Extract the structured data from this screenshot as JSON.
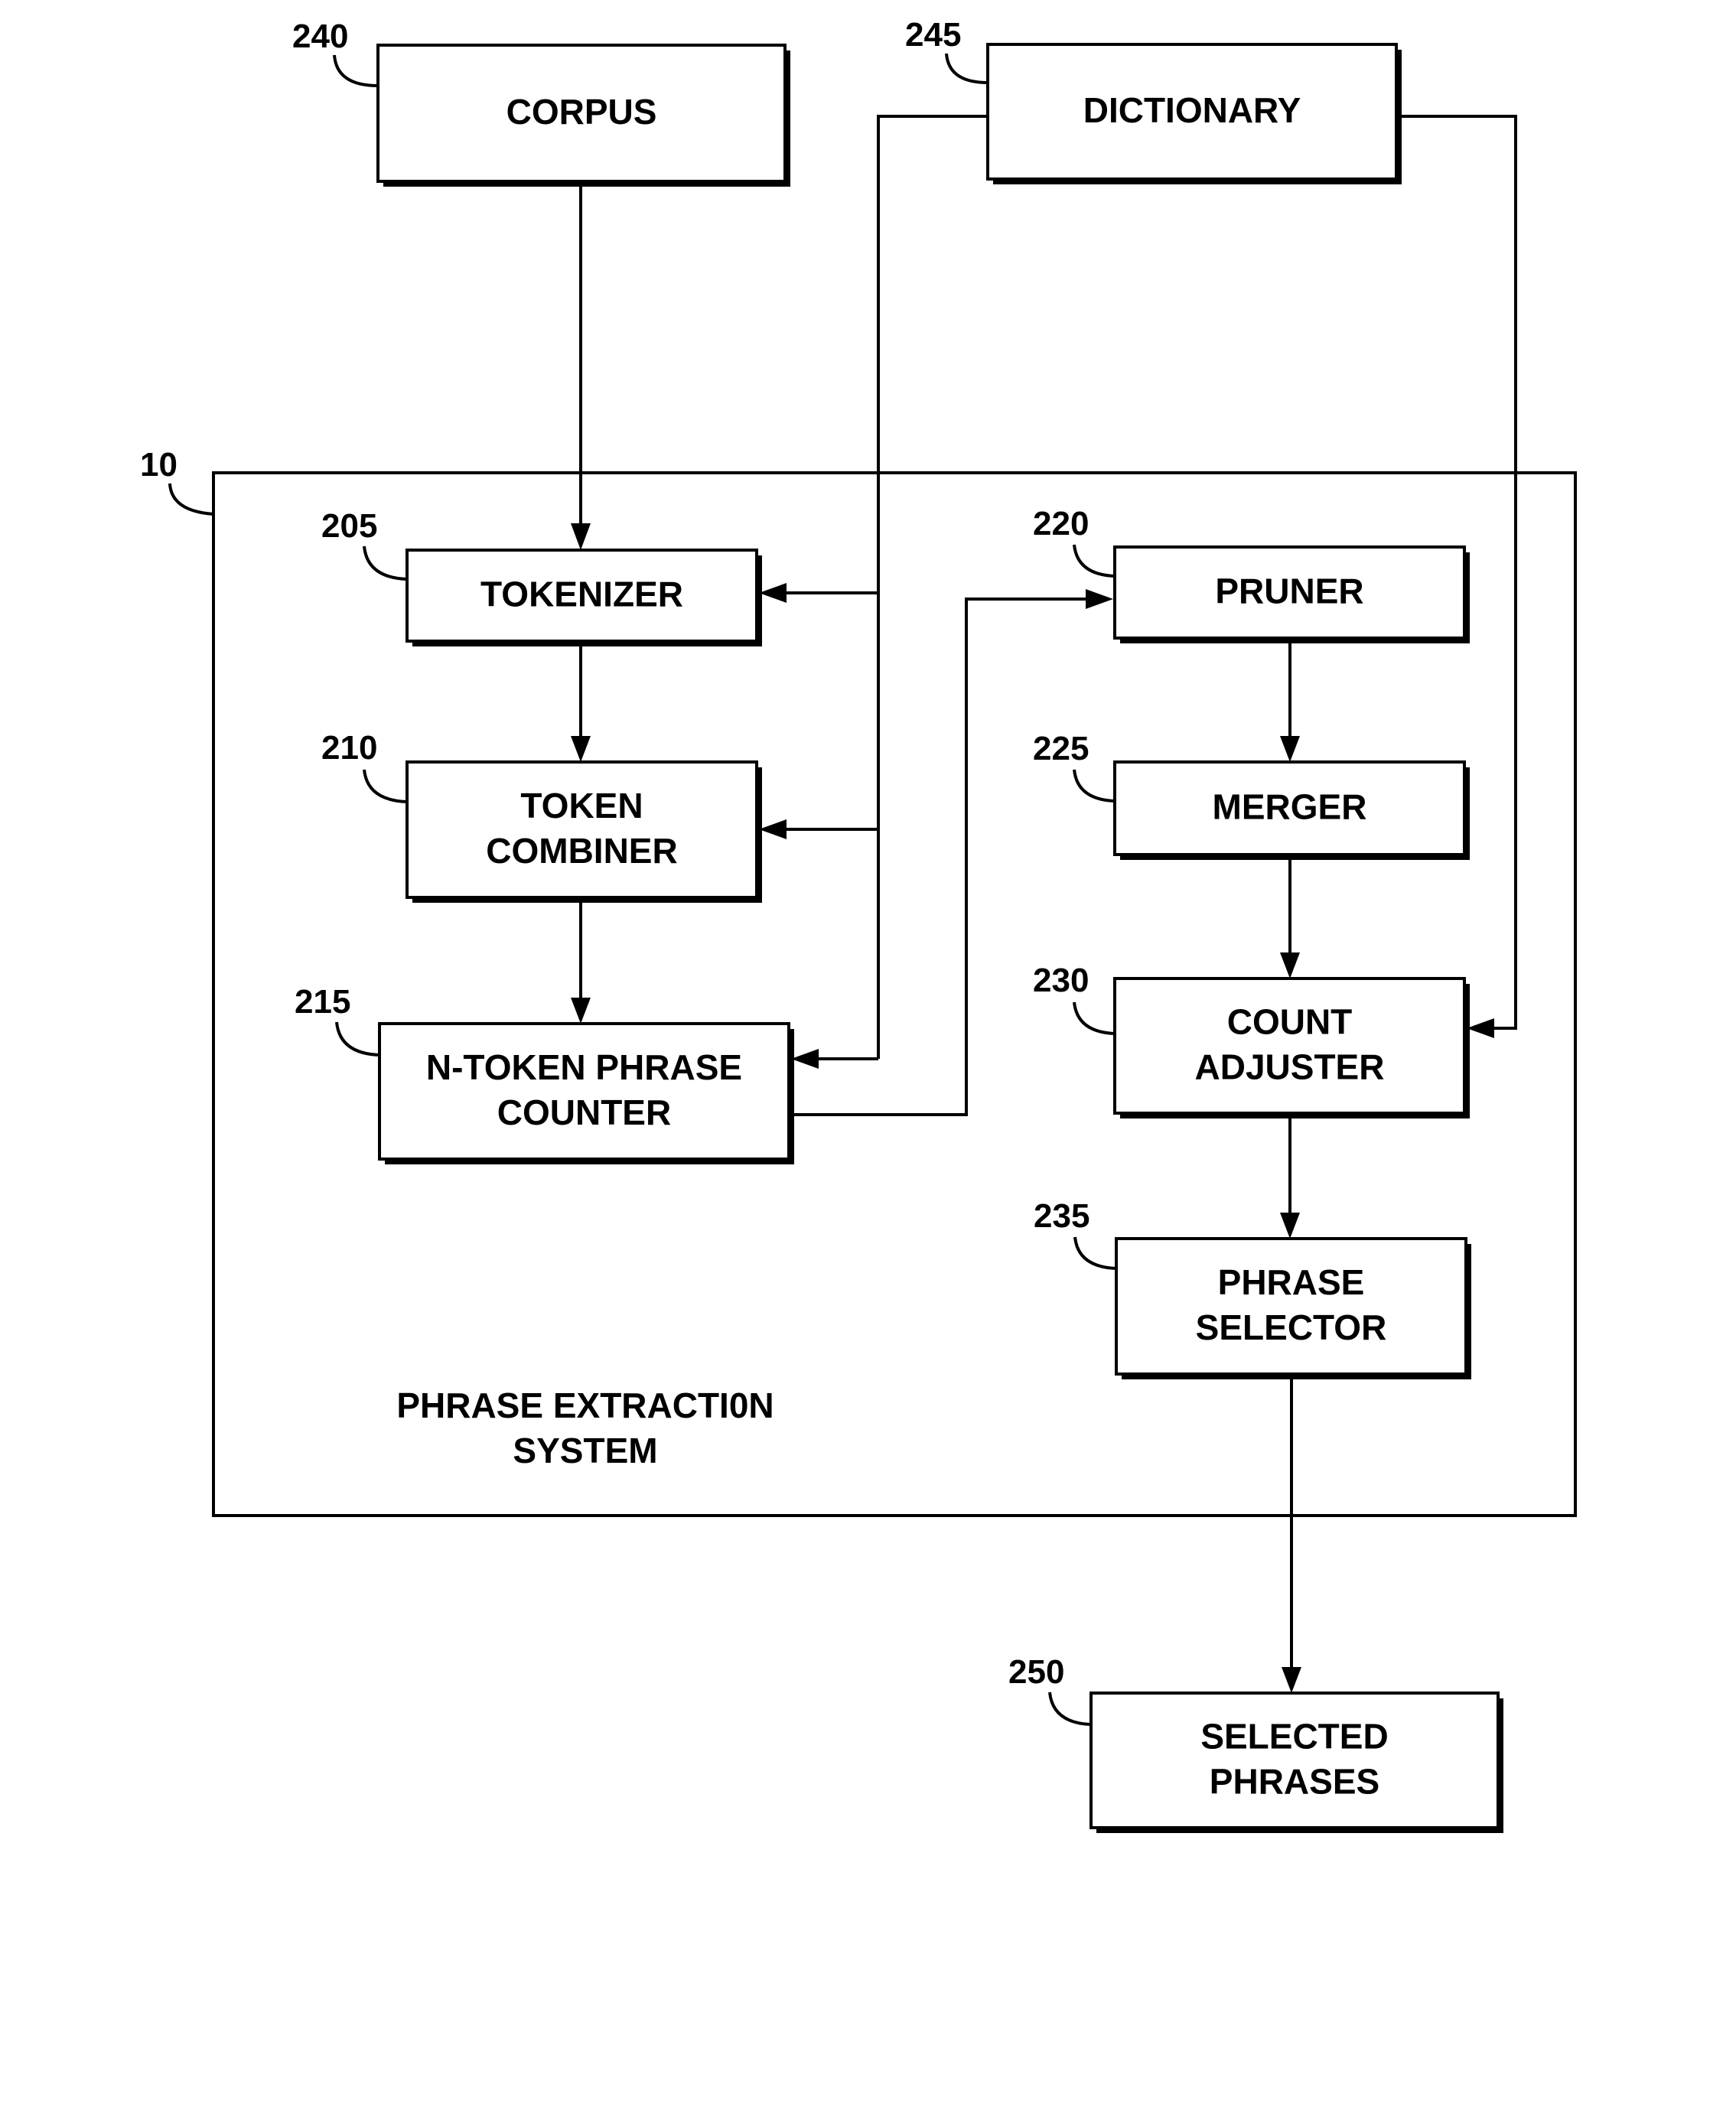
{
  "figure": {
    "system": {
      "ref": "10",
      "label_lines": [
        "PHRASE EXTRACTI0N",
        "SYSTEM"
      ]
    },
    "blocks": {
      "corpus": {
        "ref": "240",
        "lines": [
          "CORPUS"
        ]
      },
      "dictionary": {
        "ref": "245",
        "lines": [
          "DICTIONARY"
        ]
      },
      "tokenizer": {
        "ref": "205",
        "lines": [
          "TOKENIZER"
        ]
      },
      "token_combiner": {
        "ref": "210",
        "lines": [
          "TOKEN",
          "COMBINER"
        ]
      },
      "n_token_counter": {
        "ref": "215",
        "lines": [
          "N-TOKEN PHRASE",
          "COUNTER"
        ]
      },
      "pruner": {
        "ref": "220",
        "lines": [
          "PRUNER"
        ]
      },
      "merger": {
        "ref": "225",
        "lines": [
          "MERGER"
        ]
      },
      "count_adjuster": {
        "ref": "230",
        "lines": [
          "COUNT",
          "ADJUSTER"
        ]
      },
      "phrase_selector": {
        "ref": "235",
        "lines": [
          "PHRASE",
          "SELECTOR"
        ]
      },
      "selected_phrases": {
        "ref": "250",
        "lines": [
          "SELECTED",
          "PHRASES"
        ]
      }
    },
    "connections": [
      {
        "from": "corpus",
        "to": "tokenizer"
      },
      {
        "from": "dictionary",
        "to": "tokenizer"
      },
      {
        "from": "dictionary",
        "to": "token_combiner"
      },
      {
        "from": "dictionary",
        "to": "n_token_counter"
      },
      {
        "from": "dictionary",
        "to": "count_adjuster"
      },
      {
        "from": "tokenizer",
        "to": "token_combiner"
      },
      {
        "from": "token_combiner",
        "to": "n_token_counter"
      },
      {
        "from": "n_token_counter",
        "to": "pruner"
      },
      {
        "from": "pruner",
        "to": "merger"
      },
      {
        "from": "merger",
        "to": "count_adjuster"
      },
      {
        "from": "count_adjuster",
        "to": "phrase_selector"
      },
      {
        "from": "phrase_selector",
        "to": "selected_phrases"
      }
    ]
  }
}
